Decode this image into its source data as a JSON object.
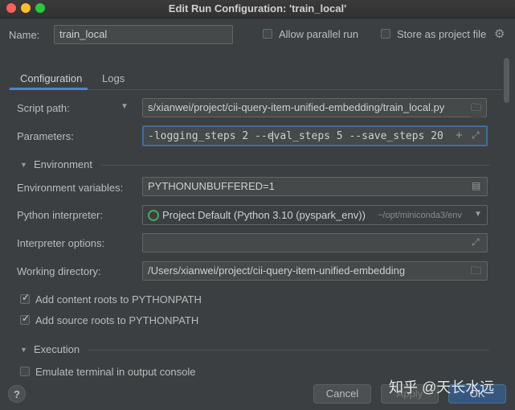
{
  "window": {
    "title": "Edit Run Configuration: 'train_local'"
  },
  "header": {
    "name_label": "Name:",
    "name_value": "train_local",
    "allow_parallel_label": "Allow parallel run",
    "allow_parallel_checked": false,
    "store_project_label": "Store as project file",
    "store_project_checked": false
  },
  "tabs": [
    {
      "label": "Configuration",
      "active": true
    },
    {
      "label": "Logs",
      "active": false
    }
  ],
  "config": {
    "script_path_label": "Script path:",
    "script_path_value": "s/xianwei/project/cii-query-item-unified-embedding/train_local.py",
    "parameters_label": "Parameters:",
    "parameters_before_caret": "-logging_steps 2  --",
    "parameters_after_caret": "eval_steps 5 --save_steps 20",
    "environment_section": "Environment",
    "env_vars_label": "Environment variables:",
    "env_vars_value": "PYTHONUNBUFFERED=1",
    "interpreter_label": "Python interpreter:",
    "interpreter_value": "Project Default (Python 3.10 (pyspark_env))",
    "interpreter_path": "~/opt/miniconda3/env",
    "interpreter_options_label": "Interpreter options:",
    "interpreter_options_value": "",
    "working_dir_label": "Working directory:",
    "working_dir_value": "/Users/xianwei/project/cii-query-item-unified-embedding",
    "content_roots_label": "Add content roots to PYTHONPATH",
    "content_roots_checked": true,
    "source_roots_label": "Add source roots to PYTHONPATH",
    "source_roots_checked": true,
    "execution_section": "Execution",
    "emulate_terminal_label": "Emulate terminal in output console",
    "emulate_terminal_checked": false
  },
  "footer": {
    "help_label": "?",
    "cancel_label": "Cancel",
    "apply_label": "Apply",
    "ok_label": "OK"
  },
  "watermark": "知乎 @天长水远",
  "colors": {
    "background": "#3c3f41",
    "field": "#45494a",
    "accent": "#4a88c7",
    "primary_button": "#365880"
  },
  "icons": [
    "gear-icon",
    "dropdown-arrow-icon",
    "folder-icon",
    "plus-icon",
    "expand-icon",
    "document-icon",
    "python-interpreter-icon",
    "chevron-down-icon"
  ]
}
